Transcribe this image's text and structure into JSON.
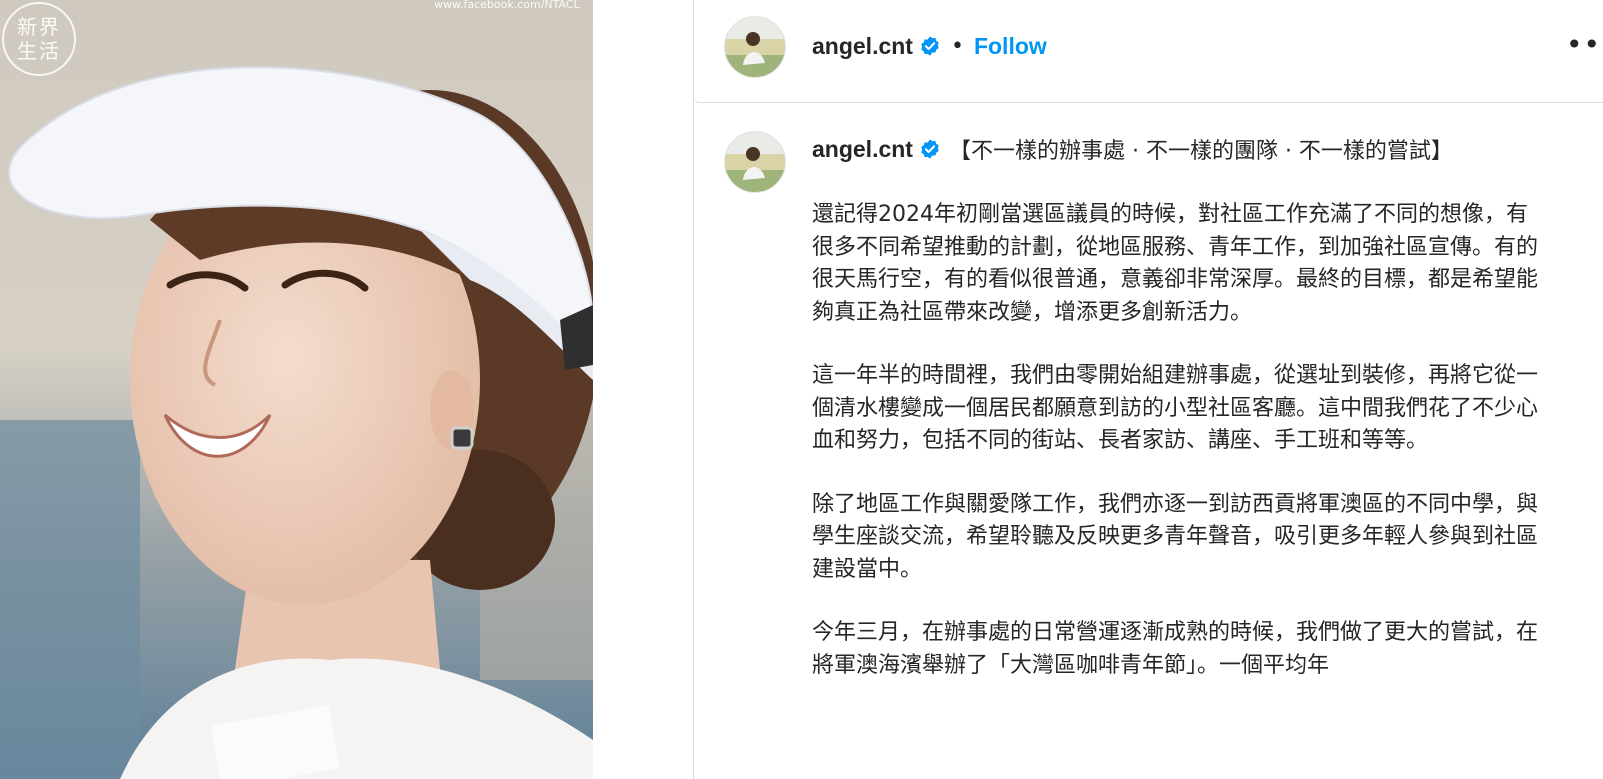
{
  "photo": {
    "watermark_url": "www.facebook.com/NTACL",
    "seal_lines": [
      "新界",
      "生活"
    ]
  },
  "header": {
    "username": "angel.cnt",
    "separator": "•",
    "follow_label": "Follow",
    "more_label": "•••"
  },
  "caption": {
    "username": "angel.cnt",
    "title": "【不一樣的辦事處 · 不一樣的團隊 · 不一樣的嘗試】",
    "paragraphs": [
      "還記得2024年初剛當選區議員的時候，對社區工作充滿了不同的想像，有很多不同希望推動的計劃，從地區服務、青年工作，到加強社區宣傳。有的很天馬行空，有的看似很普通，意義卻非常深厚。最終的目標，都是希望能夠真正為社區帶來改變，增添更多創新活力。",
      "這一年半的時間裡，我們由零開始組建辦事處，從選址到裝修，再將它從一個清水樓變成一個居民都願意到訪的小型社區客廳。這中間我們花了不少心血和努力，包括不同的街站、長者家訪、講座、手工班和等等。",
      "除了地區工作與關愛隊工作，我們亦逐一到訪西貢將軍澳區的不同中學，與學生座談交流，希望聆聽及反映更多青年聲音，吸引更多年輕人參與到社區建設當中。",
      "今年三月，在辦事處的日常營運逐漸成熟的時候，我們做了更大的嘗試，在將軍澳海濱舉辦了「大灣區咖啡青年節」。一個平均年"
    ]
  },
  "colors": {
    "accent": "#0095f6",
    "verified": "#0095f6",
    "divider": "#dbdbdb"
  },
  "icons": {
    "verified": "verified-badge-icon",
    "more": "more-options-icon"
  }
}
